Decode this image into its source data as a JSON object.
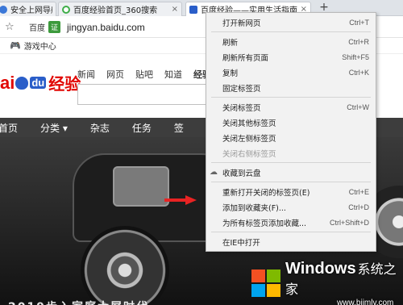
{
  "tabs": [
    {
      "label": "安全上网导航",
      "fav_color": "#3c78d8",
      "active": false
    },
    {
      "label": "百度经验首页_360搜索",
      "fav_color": "#3fae49",
      "active": false
    },
    {
      "label": "百度经验——实用生活指南",
      "fav_color": "#2a5ec9",
      "active": true
    }
  ],
  "tab_close": "×",
  "new_tab": "+",
  "address": {
    "star": "☆",
    "site_name": "百度",
    "cert": "证",
    "url": "jingyan.baidu.com"
  },
  "bookmarks": [
    {
      "icon": "🎮",
      "label": "游戏中心"
    }
  ],
  "page": {
    "logo": {
      "bai": "ai",
      "du": "du",
      "jy": "经验"
    },
    "topnav": [
      "新闻",
      "网页",
      "贴吧",
      "知道",
      "经验"
    ],
    "categories": [
      "首页",
      "分类 ▾",
      "杂志",
      "任务",
      "签"
    ],
    "hero_caption": "2019步入家庭大屏时代"
  },
  "context_menu": {
    "items": [
      {
        "label": "打开新网页",
        "shortcut": "Ctrl+T"
      },
      {
        "sep": true
      },
      {
        "label": "刷新",
        "shortcut": "Ctrl+R"
      },
      {
        "label": "刷新所有页面",
        "shortcut": "Shift+F5"
      },
      {
        "label": "复制",
        "shortcut": "Ctrl+K"
      },
      {
        "label": "固定标签页",
        "shortcut": ""
      },
      {
        "sep": true
      },
      {
        "label": "关闭标签页",
        "shortcut": "Ctrl+W"
      },
      {
        "label": "关闭其他标签页",
        "shortcut": ""
      },
      {
        "label": "关闭左侧标签页",
        "shortcut": ""
      },
      {
        "label": "关闭右侧标签页",
        "shortcut": "",
        "disabled": true
      },
      {
        "sep": true
      },
      {
        "label": "收藏到云盘",
        "shortcut": "",
        "icon": "cloud-icon"
      },
      {
        "sep": true
      },
      {
        "label": "重新打开关闭的标签页(E)",
        "shortcut": "Ctrl+E"
      },
      {
        "label": "添加到收藏夹(F)...",
        "shortcut": "Ctrl+D"
      },
      {
        "label": "为所有标签页添加收藏...",
        "shortcut": "Ctrl+Shift+D"
      },
      {
        "sep": true
      },
      {
        "label": "在IE中打开",
        "shortcut": ""
      }
    ]
  },
  "watermark": {
    "word": "Windows",
    "word_cn": "系统之家",
    "site": "www.bjjmlv.com"
  }
}
